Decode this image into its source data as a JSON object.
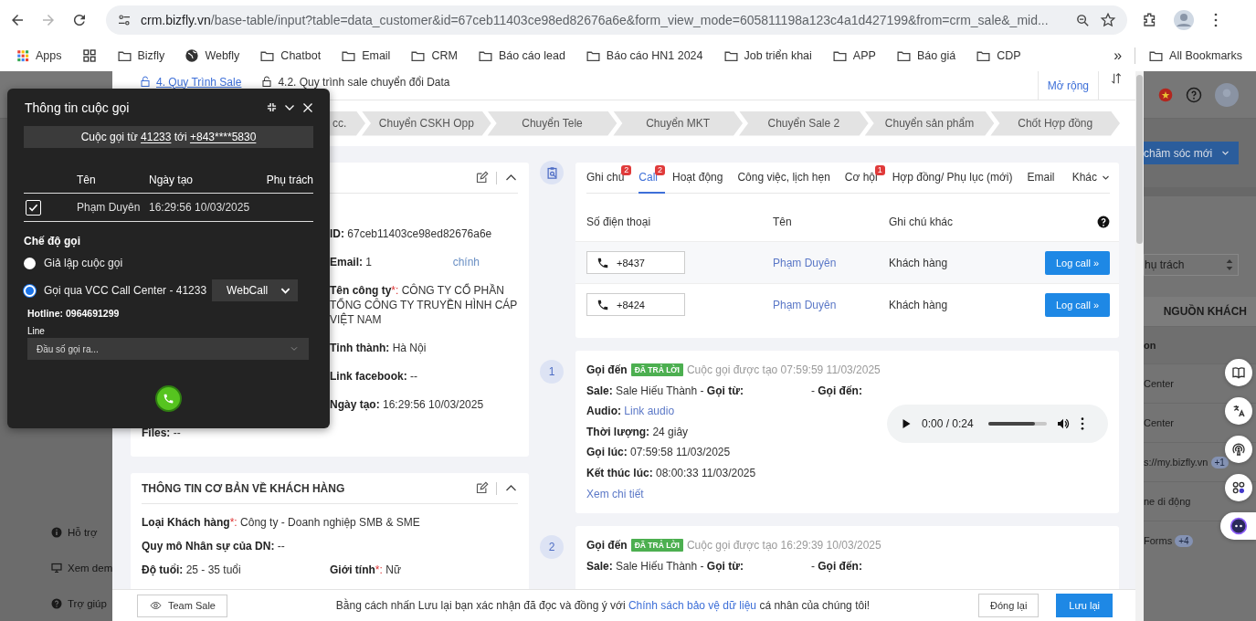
{
  "browser": {
    "url_domain": "crm.bizfly.vn",
    "url_path": "/base-table/input?table=data_customer&id=67ceb11403ce98ed82676a6e&form_view_mode=605811198a123c4a1d427199&from=crm_sale&_mid...",
    "forward_disabled": true,
    "bookmarks": [
      {
        "kind": "apps",
        "label": "Apps"
      },
      {
        "kind": "grid"
      },
      {
        "kind": "folder",
        "label": "Bizfly"
      },
      {
        "kind": "globe",
        "label": "Webfly"
      },
      {
        "kind": "folder",
        "label": "Chatbot"
      },
      {
        "kind": "folder",
        "label": "Email"
      },
      {
        "kind": "folder",
        "label": "CRM"
      },
      {
        "kind": "folder",
        "label": "Báo cáo lead"
      },
      {
        "kind": "folder",
        "label": "Báo cáo HN1 2024"
      },
      {
        "kind": "folder",
        "label": "Job triển khai"
      },
      {
        "kind": "folder",
        "label": "APP"
      },
      {
        "kind": "folder",
        "label": "Báo giá"
      },
      {
        "kind": "folder",
        "label": "CDP"
      }
    ],
    "more": "»",
    "all_bookmarks": "All Bookmarks"
  },
  "left_rail": {
    "items": [
      {
        "kind": "help",
        "label": "Hỗ trợ"
      },
      {
        "kind": "demo",
        "label": "Xem dem"
      },
      {
        "kind": "support",
        "label": "Trợ giúp"
      }
    ]
  },
  "modal": {
    "process_tabs": [
      {
        "label": "4. Quy Trình Sale",
        "selected": true
      },
      {
        "label": "4.2. Quy trình sale chuyển đổi Data",
        "selected": false
      }
    ],
    "expand": "Mở rộng",
    "pipeline": [
      "cc.",
      "Chuyển CSKH Opp",
      "Chuyển Tele",
      "Chuyển MKT",
      "Chuyển Sale 2",
      "Chuyển sản phẩm",
      "Chốt Hợp đồng"
    ],
    "info_card": {
      "fields": [
        {
          "label": "ID:",
          "value": "67ceb11403ce98ed82676a6e"
        },
        {
          "label": "Email:",
          "value": "1",
          "note": "chính"
        },
        {
          "label": "Tên công ty",
          "required_mark": "*:",
          "value": "CÔNG TY CỔ PHẦN TỔNG CÔNG TY TRUYỀN HÌNH CÁP VIỆT NAM"
        },
        {
          "label": "Tỉnh thành:",
          "value": "Hà Nội"
        },
        {
          "label": "Link facebook:",
          "value": "--"
        },
        {
          "label": "Ngày tạo:",
          "value": "16:29:56 10/03/2025"
        }
      ],
      "files": {
        "label": "Files:",
        "value": "--"
      }
    },
    "basic_card": {
      "title": "THÔNG TIN CƠ BẢN VỀ KHÁCH HÀNG",
      "fields": [
        {
          "kind": "wide",
          "label": "Loại Khách hàng",
          "required_mark": "*:",
          "value": "Công ty - Doanh nghiệp SMB & SME"
        },
        {
          "kind": "wide",
          "label": "Quy mô Nhân sự của DN:",
          "value": "--"
        },
        {
          "kind": "half",
          "label": "Độ tuổi:",
          "value": "25 - 35 tuổi"
        },
        {
          "kind": "half",
          "label": "Giới tính",
          "required_mark": "*:",
          "value": "Nữ"
        }
      ]
    },
    "activity": {
      "tabs": [
        {
          "kind": "tab",
          "label": "Ghi chú",
          "badge": "2",
          "selected": false
        },
        {
          "kind": "tab",
          "label": "Call",
          "badge": "2",
          "selected": true
        },
        {
          "kind": "tab",
          "label": "Hoạt động",
          "selected": false
        },
        {
          "kind": "tab",
          "label": "Công việc, lịch hẹn",
          "selected": false
        },
        {
          "kind": "tab",
          "label": "Cơ hội",
          "badge": "1",
          "selected": false
        },
        {
          "kind": "tab",
          "label": "Hợp đồng/ Phụ lục (mới)",
          "selected": false
        },
        {
          "kind": "tab",
          "label": "Email",
          "selected": false
        },
        {
          "kind": "dropdown",
          "label": "Khác",
          "selected": false
        }
      ],
      "columns": [
        "Số điện thoại",
        "Tên",
        "Ghi chú khác"
      ],
      "rows": [
        {
          "phone": "+8437",
          "name": "Phạm Duyên",
          "note": "Khách hàng",
          "action": "Log call »"
        },
        {
          "phone": "+8424",
          "name": "Phạm Duyên",
          "note": "Khách hàng",
          "action": "Log call »"
        }
      ]
    },
    "calls": [
      {
        "number": "1",
        "direction": "Gọi đến",
        "status": "ĐÃ TRẢ LỜI",
        "created": "Cuộc gọi được tạo 07:59:59 11/03/2025",
        "details": [
          {
            "kind": "party",
            "text": "**Sale:** Sale Hiếu Thành - **Gọi từ:**",
            "text2": "- **Gọi đến:**"
          },
          {
            "kind": "link",
            "label": "Audio:",
            "link": "Link audio"
          },
          {
            "kind": "text",
            "text": "**Thời lượng:** 24 giây"
          },
          {
            "kind": "text",
            "text": "**Gọi lúc:** 07:59:58 11/03/2025"
          },
          {
            "kind": "text",
            "text": "**Kết thúc lúc:** 08:00:33 11/03/2025"
          }
        ],
        "more_link": "Xem chi tiết",
        "player": {
          "time": "0:00 / 0:24",
          "level": 0.8
        }
      },
      {
        "number": "2",
        "direction": "Gọi đến",
        "status": "ĐÃ TRẢ LỜI",
        "created": "Cuộc gọi được tạo 16:29:39 10/03/2025",
        "details": [
          {
            "kind": "party",
            "text": "**Sale:** Sale Hiếu Thành - **Gọi từ:**",
            "text2": "- **Gọi đến:**"
          }
        ]
      }
    ],
    "footer": {
      "team_button": "Team Sale",
      "consent_prefix": "Bằng cách nhấn Lưu lại bạn xác nhận đã đọc và đồng ý với",
      "consent_link": "Chính sách bảo vệ dữ liệu",
      "consent_suffix": "cá nhân của chúng tôi!",
      "close": "Đóng lại",
      "save": "Lưu lại"
    }
  },
  "call_popup": {
    "title": "Thông tin cuộc gọi",
    "banner": {
      "prefix": "Cuộc gọi từ",
      "from": "41233",
      "middle": "tới",
      "to": "+843****5830"
    },
    "columns": [
      "Tên",
      "Ngày tạo",
      "Phụ trách"
    ],
    "rows": [
      {
        "checked": true,
        "name": "Phạm Duyên",
        "created": "16:29:56 10/03/2025"
      }
    ],
    "mode_title": "Chế độ gọi",
    "modes": [
      {
        "label": "Giả lập cuộc gọi",
        "selected": false
      },
      {
        "label": "Gọi qua VCC Call Center - 41233",
        "selected": true,
        "select": "WebCall"
      }
    ],
    "hotline": "Hotline: 0964691299",
    "line_label": "Line",
    "line_placeholder": "Đầu số gọi ra..."
  },
  "background": {
    "button": "chăm sóc mới",
    "select_value": "hụ trách",
    "column": "NGUỒN KHÁCH",
    "rows": [
      {
        "kind": "group",
        "text": "on"
      },
      {
        "kind": "row",
        "text": "Center"
      },
      {
        "kind": "row",
        "text": "Center"
      },
      {
        "kind": "row",
        "text": "s://my.bizfly.vn",
        "count": "+1"
      },
      {
        "kind": "row",
        "text": "ne di động"
      },
      {
        "kind": "row",
        "text": "Forms",
        "count": "+4"
      }
    ]
  }
}
